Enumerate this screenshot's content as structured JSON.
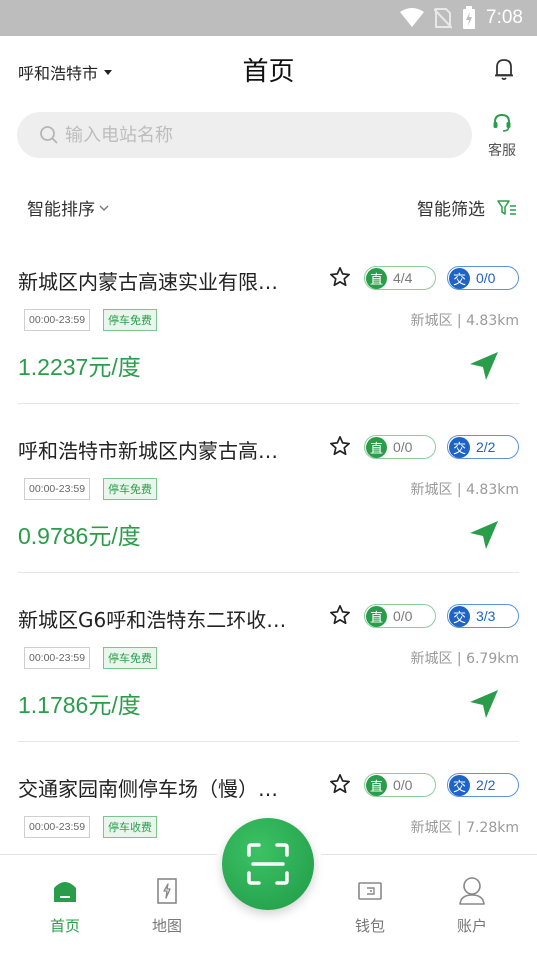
{
  "status": {
    "time": "7:08"
  },
  "header": {
    "city": "呼和浩特市",
    "title": "首页"
  },
  "search": {
    "placeholder": "输入电站名称"
  },
  "service": {
    "label": "客服"
  },
  "sortbar": {
    "sort_label": "智能排序",
    "filter_label": "智能筛选"
  },
  "stations": [
    {
      "name": "新城区内蒙古高速实业有限…",
      "dc_badge": "直",
      "dc_count": "4/4",
      "ac_badge": "交",
      "ac_count": "0/0",
      "hours": "00:00-23:59",
      "parking": "停车免费",
      "district": "新城区 | 4.83km",
      "price": "1.2237元/度"
    },
    {
      "name": "呼和浩特市新城区内蒙古高…",
      "dc_badge": "直",
      "dc_count": "0/0",
      "ac_badge": "交",
      "ac_count": "2/2",
      "hours": "00:00-23:59",
      "parking": "停车免费",
      "district": "新城区 | 4.83km",
      "price": "0.9786元/度"
    },
    {
      "name": "新城区G6呼和浩特东二环收…",
      "dc_badge": "直",
      "dc_count": "0/0",
      "ac_badge": "交",
      "ac_count": "3/3",
      "hours": "00:00-23:59",
      "parking": "停车免费",
      "district": "新城区 | 6.79km",
      "price": "1.1786元/度"
    },
    {
      "name": "交通家园南侧停车场（慢）…",
      "dc_badge": "直",
      "dc_count": "0/0",
      "ac_badge": "交",
      "ac_count": "2/2",
      "hours": "00:00-23:59",
      "parking": "停车收费",
      "district": "新城区 | 7.28km",
      "price": ""
    }
  ],
  "tabs": {
    "home": "首页",
    "map": "地图",
    "wallet": "钱包",
    "account": "账户"
  },
  "colors": {
    "accent": "#2a9d4a",
    "ac_blue": "#1e63c6"
  }
}
